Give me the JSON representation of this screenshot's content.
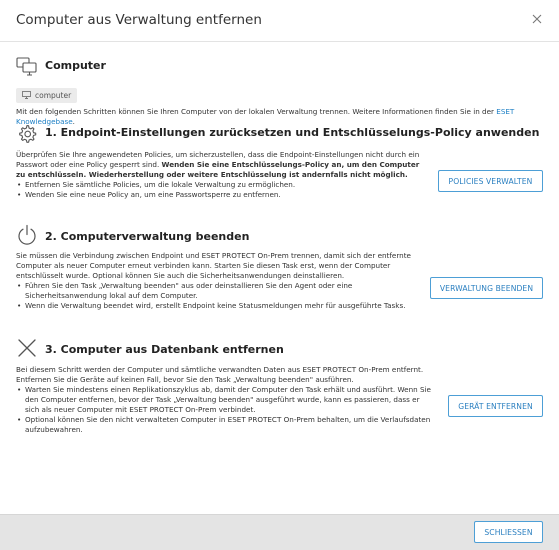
{
  "dialog": {
    "title": "Computer aus Verwaltung entfernen",
    "close_icon": "close-icon"
  },
  "computer": {
    "heading": "Computer",
    "chip_label": "computer",
    "desc": "Mit den folgenden Schritten können Sie Ihren Computer von der lokalen Verwaltung trennen. Weitere Informationen finden Sie in der ",
    "link_label": "ESET Knowledgebase",
    "desc_end": "."
  },
  "step1": {
    "heading": "1. Endpoint-Einstellungen zurücksetzen und Entschlüsselungs-Policy anwenden",
    "text_plain": "Überprüfen Sie Ihre angewendeten Policies, um sicherzustellen, dass die Endpoint-Einstellungen nicht durch ein Passwort oder eine Policy gesperrt sind. ",
    "text_bold": "Wenden Sie eine Entschlüsselungs-Policy an, um den Computer zu entschlüsseln. Wiederherstellung oder weitere Entschlüsselung ist andernfalls nicht möglich.",
    "bullets": [
      "Entfernen Sie sämtliche Policies, um die lokale Verwaltung zu ermöglichen.",
      "Wenden Sie eine neue Policy an, um eine Passwortsperre zu entfernen."
    ],
    "button_label": "POLICIES VERWALTEN"
  },
  "step2": {
    "heading": "2. Computerverwaltung beenden",
    "text": "Sie müssen die Verbindung zwischen Endpoint und ESET PROTECT On-Prem trennen, damit sich der entfernte Computer als neuer Computer erneut verbinden kann. Starten Sie diesen Task erst, wenn der Computer entschlüsselt wurde. Optional können Sie auch die Sicherheitsanwendungen deinstallieren.",
    "bullets": [
      "Führen Sie den Task „Verwaltung beenden\" aus oder deinstallieren Sie den Agent oder eine Sicherheitsanwendung lokal auf dem Computer.",
      "Wenn die Verwaltung beendet wird, erstellt Endpoint keine Statusmeldungen mehr für ausgeführte Tasks."
    ],
    "button_label": "VERWALTUNG BEENDEN"
  },
  "step3": {
    "heading": "3. Computer aus Datenbank entfernen",
    "text": "Bei diesem Schritt werden der Computer und sämtliche verwandten Daten aus ESET PROTECT On-Prem entfernt. Entfernen Sie die Geräte auf keinen Fall, bevor Sie den Task „Verwaltung beenden\" ausführen.",
    "bullets": [
      "Warten Sie mindestens einen Replikationszyklus ab, damit der Computer den Task erhält und ausführt. Wenn Sie den Computer entfernen, bevor der Task „Verwaltung beenden\" ausgeführt wurde, kann es passieren, dass er sich als neuer Computer mit ESET PROTECT On-Prem verbindet.",
      "Optional können Sie den nicht verwalteten Computer in ESET PROTECT On-Prem behalten, um die Verlaufsdaten aufzubewahren."
    ],
    "button_label": "GERÄT ENTFERNEN"
  },
  "footer": {
    "close_button_label": "SCHLIESSEN"
  }
}
